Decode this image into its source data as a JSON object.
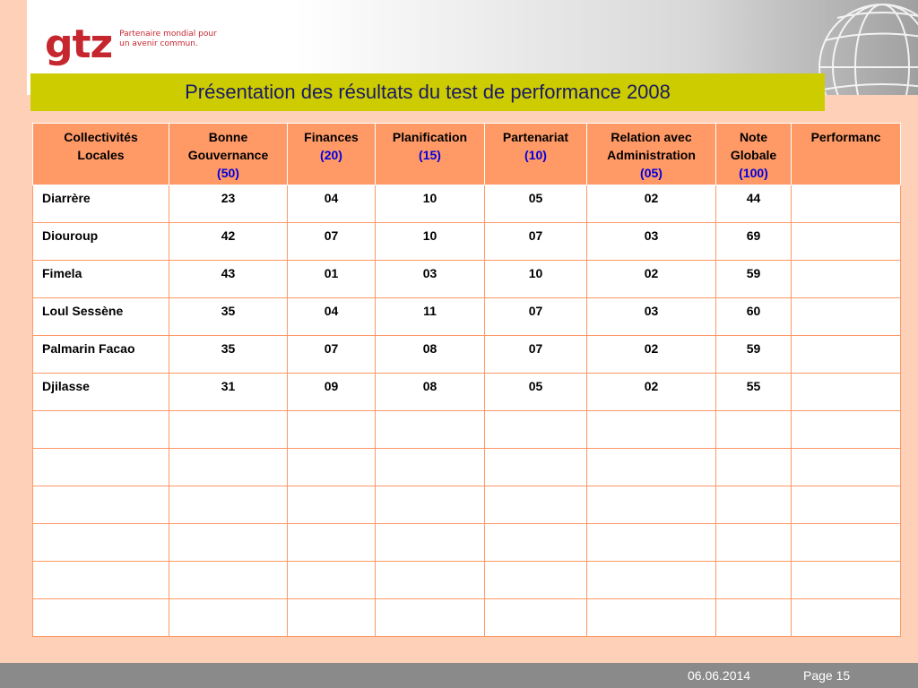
{
  "logo": {
    "mark": "gtz",
    "text_line1": "Partenaire mondial pour",
    "text_line2": "un avenir commun."
  },
  "title": "Présentation des résultats du test de performance 2008",
  "table": {
    "headers": [
      {
        "label_lines": [
          "Collectivités",
          "Locales"
        ],
        "unit": ""
      },
      {
        "label_lines": [
          "Bonne",
          "Gouvernance"
        ],
        "unit": "(50)"
      },
      {
        "label_lines": [
          "Finances"
        ],
        "unit": "(20)"
      },
      {
        "label_lines": [
          "Planification"
        ],
        "unit": "(15)"
      },
      {
        "label_lines": [
          "Partenariat"
        ],
        "unit": "(10)"
      },
      {
        "label_lines": [
          "Relation avec",
          "Administration"
        ],
        "unit": "(05)"
      },
      {
        "label_lines": [
          "Note",
          "Globale"
        ],
        "unit": "(100)"
      },
      {
        "label_lines": [
          "Performanc"
        ],
        "unit": ""
      }
    ],
    "rows": [
      [
        "Diarrère",
        "23",
        "04",
        "10",
        "05",
        "02",
        "44",
        ""
      ],
      [
        "Diouroup",
        "42",
        "07",
        "10",
        "07",
        "03",
        "69",
        ""
      ],
      [
        "Fimela",
        "43",
        "01",
        "03",
        "10",
        "02",
        "59",
        ""
      ],
      [
        "Loul Sessène",
        "35",
        "04",
        "11",
        "07",
        "03",
        "60",
        ""
      ],
      [
        "Palmarin Facao",
        "35",
        "07",
        "08",
        "07",
        "02",
        "59",
        ""
      ],
      [
        "Djilasse",
        "31",
        "09",
        "08",
        "05",
        "02",
        "55",
        ""
      ],
      [
        "",
        "",
        "",
        "",
        "",
        "",
        "",
        ""
      ],
      [
        "",
        "",
        "",
        "",
        "",
        "",
        "",
        ""
      ],
      [
        "",
        "",
        "",
        "",
        "",
        "",
        "",
        ""
      ],
      [
        "",
        "",
        "",
        "",
        "",
        "",
        "",
        ""
      ],
      [
        "",
        "",
        "",
        "",
        "",
        "",
        "",
        ""
      ],
      [
        "",
        "",
        "",
        "",
        "",
        "",
        "",
        ""
      ]
    ]
  },
  "footer": {
    "date": "06.06.2014",
    "page": "Page 15"
  },
  "colors": {
    "background": "#ffd0b8",
    "title_bar": "#cccc00",
    "header_fill": "#ff9966",
    "unit_text": "#0000dd",
    "logo": "#c6262e"
  }
}
